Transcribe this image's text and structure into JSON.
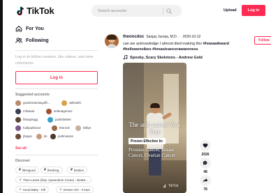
{
  "header": {
    "logo_text": "TikTok",
    "search_placeholder": "Search accounts",
    "upload_label": "Upload",
    "login_label": "Log in"
  },
  "sidebar": {
    "nav": [
      {
        "label": "For You",
        "icon": "home-icon"
      },
      {
        "label": "Following",
        "icon": "people-icon"
      }
    ],
    "login_prompt": "Log in to follow creators, like videos, and view comments.",
    "login_button": "Log in",
    "suggested_title": "Suggested accounts",
    "suggested": [
      {
        "name": "gordonramsayoffi...",
        "color": "#b88a6a"
      },
      {
        "name": "willsmith",
        "color": "#d9a04a"
      },
      {
        "name": "mrbeast",
        "color": "#3a4050"
      },
      {
        "name": "selenagomez",
        "color": "#a0522d"
      },
      {
        "name": "bhaoplugg",
        "color": "#5a4636"
      },
      {
        "name": "justinbieber",
        "color": "#3aa0c8"
      },
      {
        "name": "fueljauthicial",
        "color": "#7a5a8a"
      },
      {
        "name": "therock",
        "color": "#9a6a4a"
      },
      {
        "name": "billiye",
        "color": "#c8b0a0"
      },
      {
        "name": "jhayyn",
        "color": "#6a4a3a"
      },
      {
        "name": "jlo",
        "color": "#c89a7a"
      },
      {
        "name": "joshmanne",
        "color": "#4a3a2a"
      }
    ],
    "see_all": "See all",
    "discover_title": "Discover",
    "discover": [
      {
        "glyph": "#",
        "label": "lifeisgood"
      },
      {
        "glyph": "#",
        "label": "thesking"
      },
      {
        "glyph": "#",
        "label": "basties"
      },
      {
        "glyph": "♫",
        "label": "Then Leave (feat. Queendom Come) - BeatK..."
      },
      {
        "glyph": "♫",
        "label": "Hood Baby - Kifi"
      },
      {
        "glyph": "♫",
        "label": "Dream Girl - Il Sais"
      }
    ]
  },
  "post": {
    "username": "theoncdoc",
    "nickname": "Sanjay Juneja, M.D.",
    "date": "2020-10-12",
    "caption_text": "can we acknowledge I almost died making this ",
    "caption_tags": "#howawkward #hellowenvibes #breastcancerawareness",
    "music": "Spooky, Scary Skeletons - Andrew Gold",
    "follow_label": "Follow",
    "video": {
      "title": "The anti-cancer Yew Tree",
      "box_heading": "Proven Effective In:",
      "box_text": "Prostate Cancer, Breast Cancer, Ovarian Cancer",
      "watermark": "TikTok"
    },
    "actions": [
      {
        "icon": "heart-icon",
        "count": "2026"
      },
      {
        "icon": "comment-icon",
        "count": "48"
      },
      {
        "icon": "share-icon",
        "count": "78"
      }
    ]
  },
  "colors": {
    "brand": "#fe2c55",
    "text": "#161823",
    "muted": "#a7a7ab"
  }
}
